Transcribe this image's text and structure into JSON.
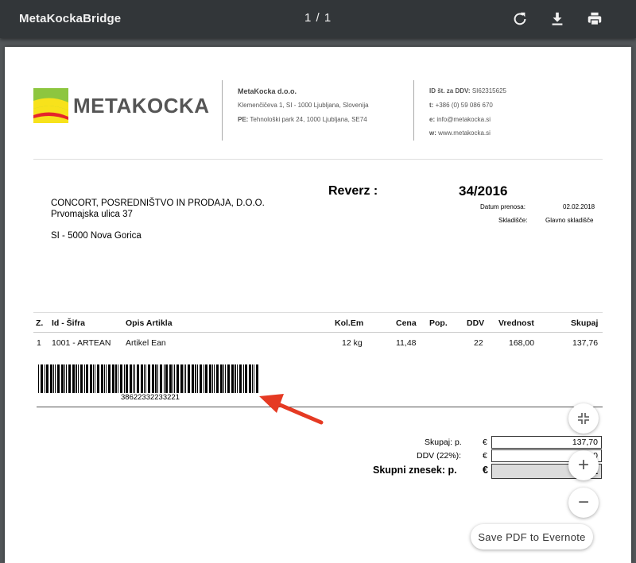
{
  "toolbar": {
    "app_title": "MetaKockaBridge",
    "page_indicator": "1 / 1",
    "rotate_icon": "rotate-icon",
    "download_icon": "download-icon",
    "print_icon": "print-icon"
  },
  "company": {
    "logo_text": "METAKOCKA",
    "name": "MetaKocka d.o.o.",
    "address": "Klemenčičeva 1, SI - 1000 Ljubljana, Slovenija",
    "pe_label": "PE:",
    "pe_value": "Tehnološki park 24, 1000 Ljubljana, SE74",
    "vat_label": "ID št. za DDV:",
    "vat_value": "SI62315625",
    "tel_label": "t:",
    "tel_value": "+386 (0) 59 086 670",
    "email_label": "e:",
    "email_value": "info@metakocka.si",
    "web_label": "w:",
    "web_value": "www.metakocka.si"
  },
  "customer": {
    "name": "CONCORT, POSREDNIŠTVO IN PRODAJA, D.O.O.",
    "street": "Prvomajska ulica 37",
    "city": "SI - 5000 Nova Gorica"
  },
  "document": {
    "title": "Reverz :",
    "number": "34/2016",
    "date_label": "Datum prenosa:",
    "date_value": "02.02.2018",
    "warehouse_label": "Skladišče:",
    "warehouse_value": "Glavno skladišče"
  },
  "table": {
    "headers": [
      "Z.",
      "Id - Šifra",
      "Opis Artikla",
      "Kol.Em",
      "Cena",
      "Pop.",
      "DDV",
      "Vrednost",
      "Skupaj"
    ],
    "rows": [
      [
        "1",
        "1001 - ARTEAN",
        "Artikel Ean",
        "12 kg",
        "11,48",
        "",
        "22",
        "168,00",
        "137,76"
      ]
    ]
  },
  "barcode": {
    "number": "38622332233221"
  },
  "totals": {
    "subtotal_label": "Skupaj: p.",
    "currency": "€",
    "subtotal_value": "137,70",
    "vat_label": "DDV (22%):",
    "vat_value": "30",
    "grand_label": "Skupni znesek: p.",
    "grand_value": "1"
  },
  "controls": {
    "fit_icon": "fit-to-page-icon",
    "zoom_in_icon": "zoom-in-icon",
    "zoom_out_icon": "zoom-out-icon",
    "evernote_label": "Save PDF to Evernote"
  },
  "annotation": {
    "arrow_color": "#e53a23"
  }
}
